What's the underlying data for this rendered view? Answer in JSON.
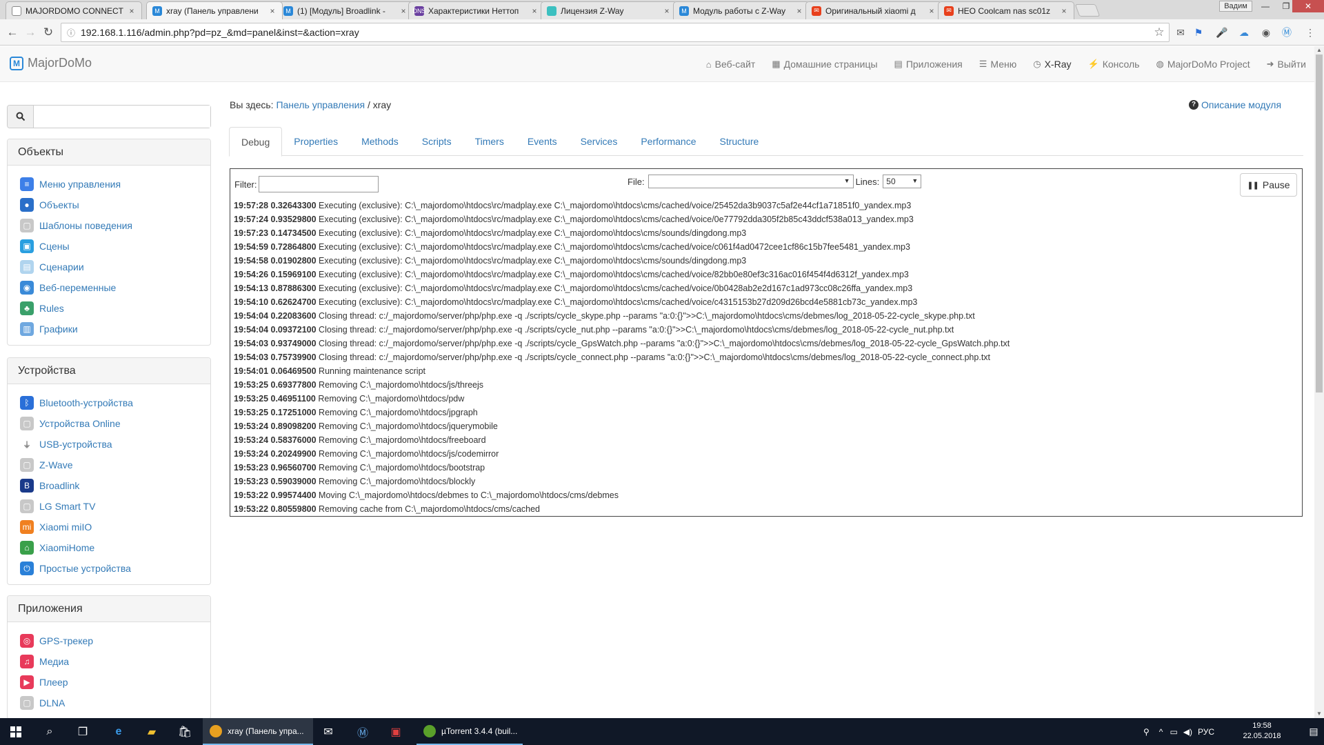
{
  "browser": {
    "tabs": [
      {
        "title": "MAJORDOMO CONNECT",
        "color": "#ffffff",
        "glyph": "□"
      },
      {
        "title": "xray (Панель управлени",
        "color": "#2a88d8",
        "glyph": "M"
      },
      {
        "title": "(1) [Модуль] Broadlink -",
        "color": "#2a88d8",
        "glyph": "M"
      },
      {
        "title": "Характеристики Неттоп",
        "color": "#6a3fa0",
        "glyph": "DNS"
      },
      {
        "title": "Лицензия Z-Way",
        "color": "#3cc0c0",
        "glyph": ""
      },
      {
        "title": "Модуль работы с Z-Way",
        "color": "#2a88d8",
        "glyph": "M"
      },
      {
        "title": "Оригинальный xiaomi д",
        "color": "#e8401c",
        "glyph": "✉"
      },
      {
        "title": "HEO Coolcam nas sc01z",
        "color": "#e8401c",
        "glyph": "✉"
      }
    ],
    "window_user": "Вадим",
    "url": "192.168.1.116/admin.php?pd=pz_&md=panel&inst=&action=xray"
  },
  "navbar": {
    "brand": "MajorDoMo",
    "links": [
      {
        "icon": "⌂",
        "label": "Веб-сайт"
      },
      {
        "icon": "▦",
        "label": "Домашние страницы"
      },
      {
        "icon": "▤",
        "label": "Приложения"
      },
      {
        "icon": "☰",
        "label": "Меню"
      },
      {
        "icon": "◷",
        "label": "X-Ray"
      },
      {
        "icon": "⚡",
        "label": "Консоль"
      },
      {
        "icon": "◍",
        "label": "MajorDoMo Project"
      },
      {
        "icon": "➜",
        "label": "Выйти"
      }
    ]
  },
  "sidebar": {
    "sections": [
      {
        "title": "Объекты",
        "items": [
          {
            "label": "Меню управления",
            "icon": "menu",
            "color": "#3d7fe8"
          },
          {
            "label": "Объекты",
            "icon": "globe",
            "color": "#2a6fc9"
          },
          {
            "label": "Шаблоны поведения",
            "icon": "template",
            "color": "#c8c8c8"
          },
          {
            "label": "Сцены",
            "icon": "scenes",
            "color": "#2a9fe0"
          },
          {
            "label": "Сценарии",
            "icon": "scripts",
            "color": "#b0d4ee"
          },
          {
            "label": "Веб-переменные",
            "icon": "web",
            "color": "#3a8ad8"
          },
          {
            "label": "Rules",
            "icon": "rules",
            "color": "#3aa06a"
          },
          {
            "label": "Графики",
            "icon": "charts",
            "color": "#6fa8e0"
          }
        ]
      },
      {
        "title": "Устройства",
        "items": [
          {
            "label": "Bluetooth-устройства",
            "icon": "bluetooth",
            "color": "#2a6fd8"
          },
          {
            "label": "Устройства Online",
            "icon": "online",
            "color": "#c8c8c8"
          },
          {
            "label": "USB-устройства",
            "icon": "usb",
            "color": "#ffffff"
          },
          {
            "label": "Z-Wave",
            "icon": "zwave",
            "color": "#c8c8c8"
          },
          {
            "label": "Broadlink",
            "icon": "broadlink",
            "color": "#1a3a8a"
          },
          {
            "label": "LG Smart TV",
            "icon": "tv",
            "color": "#c8c8c8"
          },
          {
            "label": "Xiaomi miIO",
            "icon": "xiaomi",
            "color": "#f08020"
          },
          {
            "label": "XiaomiHome",
            "icon": "home",
            "color": "#3aa04a"
          },
          {
            "label": "Простые устройства",
            "icon": "power",
            "color": "#2a80d8"
          }
        ]
      },
      {
        "title": "Приложения",
        "items": [
          {
            "label": "GPS-трекер",
            "icon": "gps",
            "color": "#e83a5a"
          },
          {
            "label": "Медиа",
            "icon": "media",
            "color": "#e83a5a"
          },
          {
            "label": "Плеер",
            "icon": "player",
            "color": "#e83a5a"
          },
          {
            "label": "DLNA",
            "icon": "dlna",
            "color": "#c8c8c8"
          }
        ]
      }
    ]
  },
  "main": {
    "breadcrumb_prefix": "Вы здесь:",
    "breadcrumb_link": "Панель управления",
    "breadcrumb_sep": "/",
    "breadcrumb_current": "xray",
    "module_help": "Описание модуля",
    "tabs": [
      "Debug",
      "Properties",
      "Methods",
      "Scripts",
      "Timers",
      "Events",
      "Services",
      "Performance",
      "Structure"
    ],
    "filter_label": "Filter:",
    "filter_value": "",
    "file_label": "File:",
    "file_value": "",
    "lines_label": "Lines:",
    "lines_value": "50",
    "pause_label": "Pause",
    "log": [
      {
        "ts": "19:57:28 0.32643300",
        "msg": "Executing (exclusive): C:\\_majordomo\\htdocs\\rc/madplay.exe C:\\_majordomo\\htdocs\\cms/cached/voice/25452da3b9037c5af2e44cf1a71851f0_yandex.mp3"
      },
      {
        "ts": "19:57:24 0.93529800",
        "msg": "Executing (exclusive): C:\\_majordomo\\htdocs\\rc/madplay.exe C:\\_majordomo\\htdocs\\cms/cached/voice/0e77792dda305f2b85c43ddcf538a013_yandex.mp3"
      },
      {
        "ts": "19:57:23 0.14734500",
        "msg": "Executing (exclusive): C:\\_majordomo\\htdocs\\rc/madplay.exe C:\\_majordomo\\htdocs\\cms/sounds/dingdong.mp3"
      },
      {
        "ts": "19:54:59 0.72864800",
        "msg": "Executing (exclusive): C:\\_majordomo\\htdocs\\rc/madplay.exe C:\\_majordomo\\htdocs\\cms/cached/voice/c061f4ad0472cee1cf86c15b7fee5481_yandex.mp3"
      },
      {
        "ts": "19:54:58 0.01902800",
        "msg": "Executing (exclusive): C:\\_majordomo\\htdocs\\rc/madplay.exe C:\\_majordomo\\htdocs\\cms/sounds/dingdong.mp3"
      },
      {
        "ts": "19:54:26 0.15969100",
        "msg": "Executing (exclusive): C:\\_majordomo\\htdocs\\rc/madplay.exe C:\\_majordomo\\htdocs\\cms/cached/voice/82bb0e80ef3c316ac016f454f4d6312f_yandex.mp3"
      },
      {
        "ts": "19:54:13 0.87886300",
        "msg": "Executing (exclusive): C:\\_majordomo\\htdocs\\rc/madplay.exe C:\\_majordomo\\htdocs\\cms/cached/voice/0b0428ab2e2d167c1ad973cc08c26ffa_yandex.mp3"
      },
      {
        "ts": "19:54:10 0.62624700",
        "msg": "Executing (exclusive): C:\\_majordomo\\htdocs\\rc/madplay.exe C:\\_majordomo\\htdocs\\cms/cached/voice/c4315153b27d209d26bcd4e5881cb73c_yandex.mp3"
      },
      {
        "ts": "19:54:04 0.22083600",
        "msg": "Closing thread: c:/_majordomo/server/php/php.exe -q ./scripts/cycle_skype.php --params \"a:0:{}\">>C:\\_majordomo\\htdocs\\cms/debmes/log_2018-05-22-cycle_skype.php.txt"
      },
      {
        "ts": "19:54:04 0.09372100",
        "msg": "Closing thread: c:/_majordomo/server/php/php.exe -q ./scripts/cycle_nut.php --params \"a:0:{}\">>C:\\_majordomo\\htdocs\\cms/debmes/log_2018-05-22-cycle_nut.php.txt"
      },
      {
        "ts": "19:54:03 0.93749000",
        "msg": "Closing thread: c:/_majordomo/server/php/php.exe -q ./scripts/cycle_GpsWatch.php --params \"a:0:{}\">>C:\\_majordomo\\htdocs\\cms/debmes/log_2018-05-22-cycle_GpsWatch.php.txt"
      },
      {
        "ts": "19:54:03 0.75739900",
        "msg": "Closing thread: c:/_majordomo/server/php/php.exe -q ./scripts/cycle_connect.php --params \"a:0:{}\">>C:\\_majordomo\\htdocs\\cms/debmes/log_2018-05-22-cycle_connect.php.txt"
      },
      {
        "ts": "19:54:01 0.06469500",
        "msg": "Running maintenance script"
      },
      {
        "ts": "19:53:25 0.69377800",
        "msg": "Removing C:\\_majordomo\\htdocs/js/threejs"
      },
      {
        "ts": "19:53:25 0.46951100",
        "msg": "Removing C:\\_majordomo\\htdocs/pdw"
      },
      {
        "ts": "19:53:25 0.17251000",
        "msg": "Removing C:\\_majordomo\\htdocs/jpgraph"
      },
      {
        "ts": "19:53:24 0.89098200",
        "msg": "Removing C:\\_majordomo\\htdocs/jquerymobile"
      },
      {
        "ts": "19:53:24 0.58376000",
        "msg": "Removing C:\\_majordomo\\htdocs/freeboard"
      },
      {
        "ts": "19:53:24 0.20249900",
        "msg": "Removing C:\\_majordomo\\htdocs/js/codemirror"
      },
      {
        "ts": "19:53:23 0.96560700",
        "msg": "Removing C:\\_majordomo\\htdocs/bootstrap"
      },
      {
        "ts": "19:53:23 0.59039000",
        "msg": "Removing C:\\_majordomo\\htdocs/blockly"
      },
      {
        "ts": "19:53:22 0.99574400",
        "msg": "Moving C:\\_majordomo\\htdocs/debmes to C:\\_majordomo\\htdocs/cms/debmes"
      },
      {
        "ts": "19:53:22 0.80559800",
        "msg": "Removing cache from C:\\_majordomo\\htdocs/cms/cached"
      }
    ]
  },
  "taskbar": {
    "apps": [
      {
        "label": "xray (Панель упра...",
        "color": "#e8a020",
        "active": true
      },
      {
        "label": "µTorrent 3.4.4 (buil...",
        "color": "#5aa02a",
        "active": false
      }
    ],
    "lang": "РУС",
    "time": "19:58",
    "date": "22.05.2018"
  }
}
